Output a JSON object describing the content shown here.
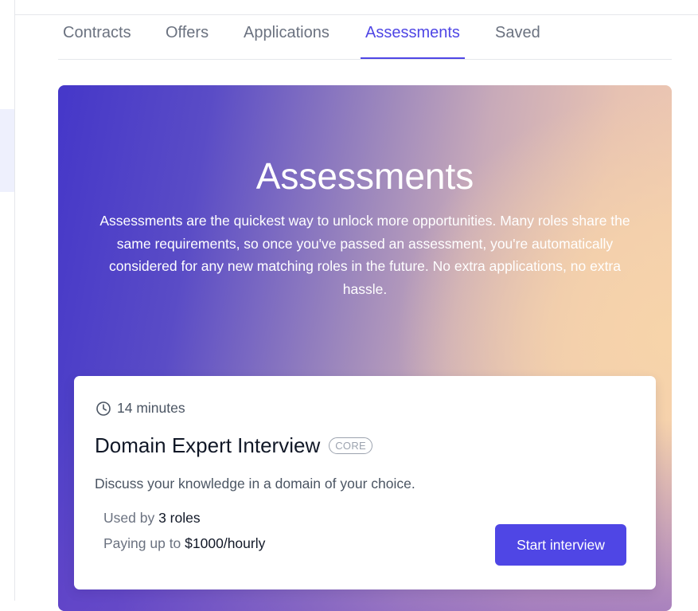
{
  "tabs": [
    {
      "label": "Contracts",
      "active": false
    },
    {
      "label": "Offers",
      "active": false
    },
    {
      "label": "Applications",
      "active": false
    },
    {
      "label": "Assessments",
      "active": true
    },
    {
      "label": "Saved",
      "active": false
    }
  ],
  "hero": {
    "title": "Assessments",
    "description": "Assessments are the quickest way to unlock more opportunities. Many roles share the same requirements, so once you've passed an assessment, you're automatically considered for any new matching roles in the future. No extra applications, no extra hassle."
  },
  "assessment_card": {
    "duration": "14 minutes",
    "duration_icon": "clock-icon",
    "title": "Domain Expert Interview",
    "badge": "CORE",
    "description": "Discuss your knowledge in a domain of your choice.",
    "used_by_label": "Used by",
    "used_by_value": "3 roles",
    "pay_label": "Paying up to",
    "pay_value": "$1000/hourly",
    "action_label": "Start interview"
  },
  "colors": {
    "accent": "#4f46e5",
    "tab_inactive": "#6b7280",
    "gradient_start": "#4537c9",
    "gradient_end": "#f7d4aa"
  }
}
